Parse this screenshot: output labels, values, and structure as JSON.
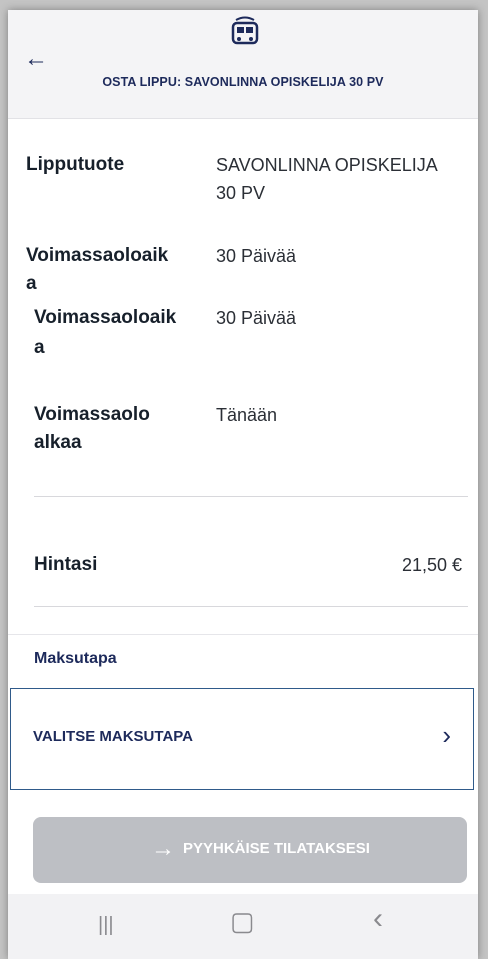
{
  "header": {
    "title": "OSTA LIPPU: SAVONLINNA OPISKELIJA 30 PV",
    "back_icon": "arrow-left-icon",
    "logo_icon": "bus-logo-icon"
  },
  "details": [
    {
      "label": "Lipputuote",
      "value_line1": "SAVONLINNA OPISKELIJA",
      "value_line2": "30 PV"
    },
    {
      "label_line1": "Voimassaoloaik",
      "label_line2": "a",
      "value": "30 Päivää"
    },
    {
      "label_line1": "Voimassaoloaik",
      "label_line2": "a",
      "value": "30 Päivää"
    },
    {
      "label_line1": "Voimassaolo",
      "label_line2": "alkaa",
      "value": "Tänään"
    }
  ],
  "price": {
    "label": "Hintasi",
    "value": "21,50 €"
  },
  "payment": {
    "section_label": "Maksutapa",
    "select_label": "VALITSE MAKSUTAPA",
    "chevron_icon": "chevron-right-icon"
  },
  "swipe": {
    "label": "PYYHKÄISE TILATAKSESI",
    "arrow_icon": "arrow-right-icon"
  },
  "navbar": {
    "recents_glyph": "|||",
    "home_glyph": "▢",
    "back_glyph": "‹"
  },
  "colors": {
    "accent": "#1d2a5b",
    "border": "#2f5a8a",
    "swipe_bg": "#bdbfc4"
  }
}
